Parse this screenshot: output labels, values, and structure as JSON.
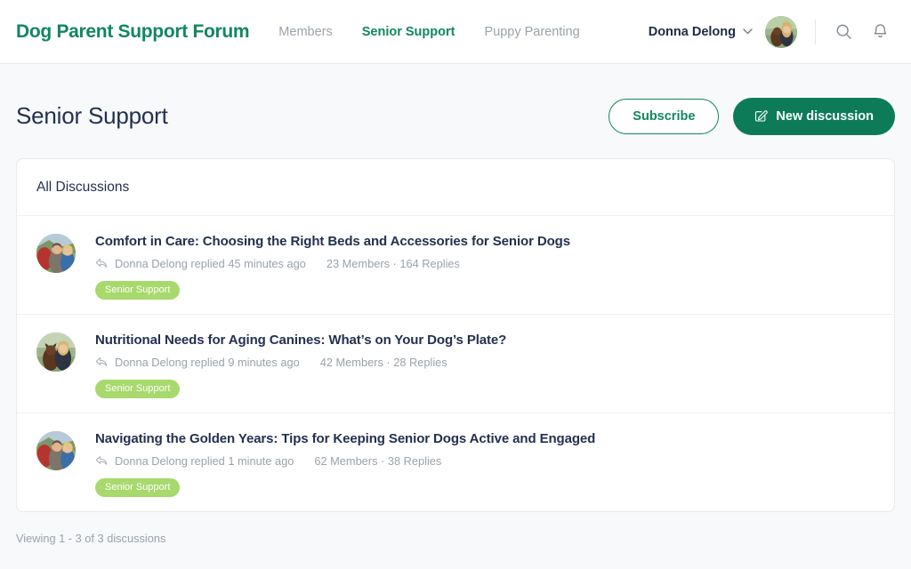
{
  "colors": {
    "brand_green": "#11875e",
    "primary_button": "#0d7b58",
    "title_navy": "#22314f",
    "muted_gray": "#9aa2aa",
    "tag_green": "#a7d96c",
    "page_background": "#f7f9fb"
  },
  "header": {
    "brand": "Dog Parent Support Forum",
    "nav": [
      {
        "label": "Members",
        "active": false
      },
      {
        "label": "Senior Support",
        "active": true
      },
      {
        "label": "Puppy Parenting",
        "active": false
      }
    ],
    "user_name": "Donna Delong",
    "caret_icon": "chevron-down-icon",
    "avatar_icon": "user-avatar",
    "search_icon": "search-icon",
    "notifications_icon": "bell-icon"
  },
  "page": {
    "title": "Senior Support",
    "subscribe_label": "Subscribe",
    "new_discussion_label": "New discussion",
    "new_discussion_icon": "compose-icon"
  },
  "discussions_card": {
    "heading": "All Discussions",
    "items": [
      {
        "title": "Comfort in Care: Choosing the Right Beds and Accessories for Senior Dogs",
        "reply_icon": "reply-arrow-icon",
        "meta_author": "Donna Delong replied 45 minutes ago",
        "meta_stats": "23 Members · 164 Replies",
        "tag": "Senior Support",
        "avatar": "avatar-hikers"
      },
      {
        "title": "Nutritional Needs for Aging Canines: What’s on Your Dog’s Plate?",
        "reply_icon": "reply-arrow-icon",
        "meta_author": "Donna Delong replied 9 minutes ago",
        "meta_stats": "42 Members · 28 Replies",
        "tag": "Senior Support",
        "avatar": "avatar-woman-dog"
      },
      {
        "title": "Navigating the Golden Years: Tips for Keeping Senior Dogs Active and Engaged",
        "reply_icon": "reply-arrow-icon",
        "meta_author": "Donna Delong replied 1 minute ago",
        "meta_stats": "62 Members · 38 Replies",
        "tag": "Senior Support",
        "avatar": "avatar-hikers"
      }
    ]
  },
  "footer": {
    "viewing_text": "Viewing 1 - 3 of 3 discussions"
  }
}
